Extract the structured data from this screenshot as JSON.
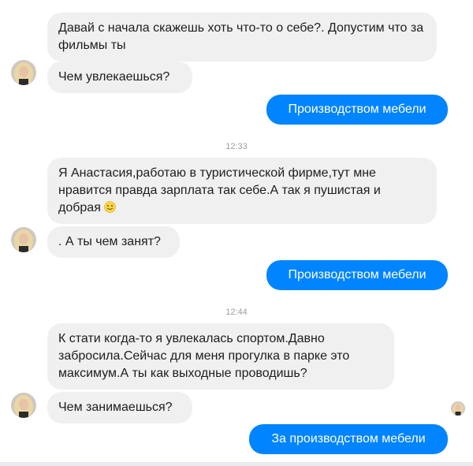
{
  "messages": [
    {
      "id": "m1",
      "text": "Давай с начала скажешь хоть что-то о себе?. Допустим что за фильмы ты"
    },
    {
      "id": "m2",
      "text": "Чем увлекаешься?"
    },
    {
      "id": "m3",
      "text": "Производством мебели"
    },
    {
      "id": "t1",
      "text": "12:33"
    },
    {
      "id": "m4",
      "text": "Я Анастасия,работаю в туристической фирме,тут мне нравится правда зарплата так себе.А так я пушистая и добрая"
    },
    {
      "id": "m5",
      "text": ". А ты чем занят?"
    },
    {
      "id": "m6",
      "text": "Производством мебели"
    },
    {
      "id": "t2",
      "text": "12:44"
    },
    {
      "id": "m7",
      "text": "К стати когда-то я увлекалась спортом.Давно забросила.Сейчас для меня прогулка в парке это максимум.А ты как выходные проводишь?"
    },
    {
      "id": "m8",
      "text": "Чем занимаешься?"
    },
    {
      "id": "m9",
      "text": "За производством мебели"
    }
  ],
  "icons": {
    "avatar": "contact-avatar-icon",
    "emoji": "smiley-emoji-icon",
    "seen": "seen-avatar-icon"
  },
  "colors": {
    "incoming_bubble": "#f1f0f0",
    "outgoing_bubble": "#0084ff",
    "timestamp": "#9aa0a6"
  }
}
